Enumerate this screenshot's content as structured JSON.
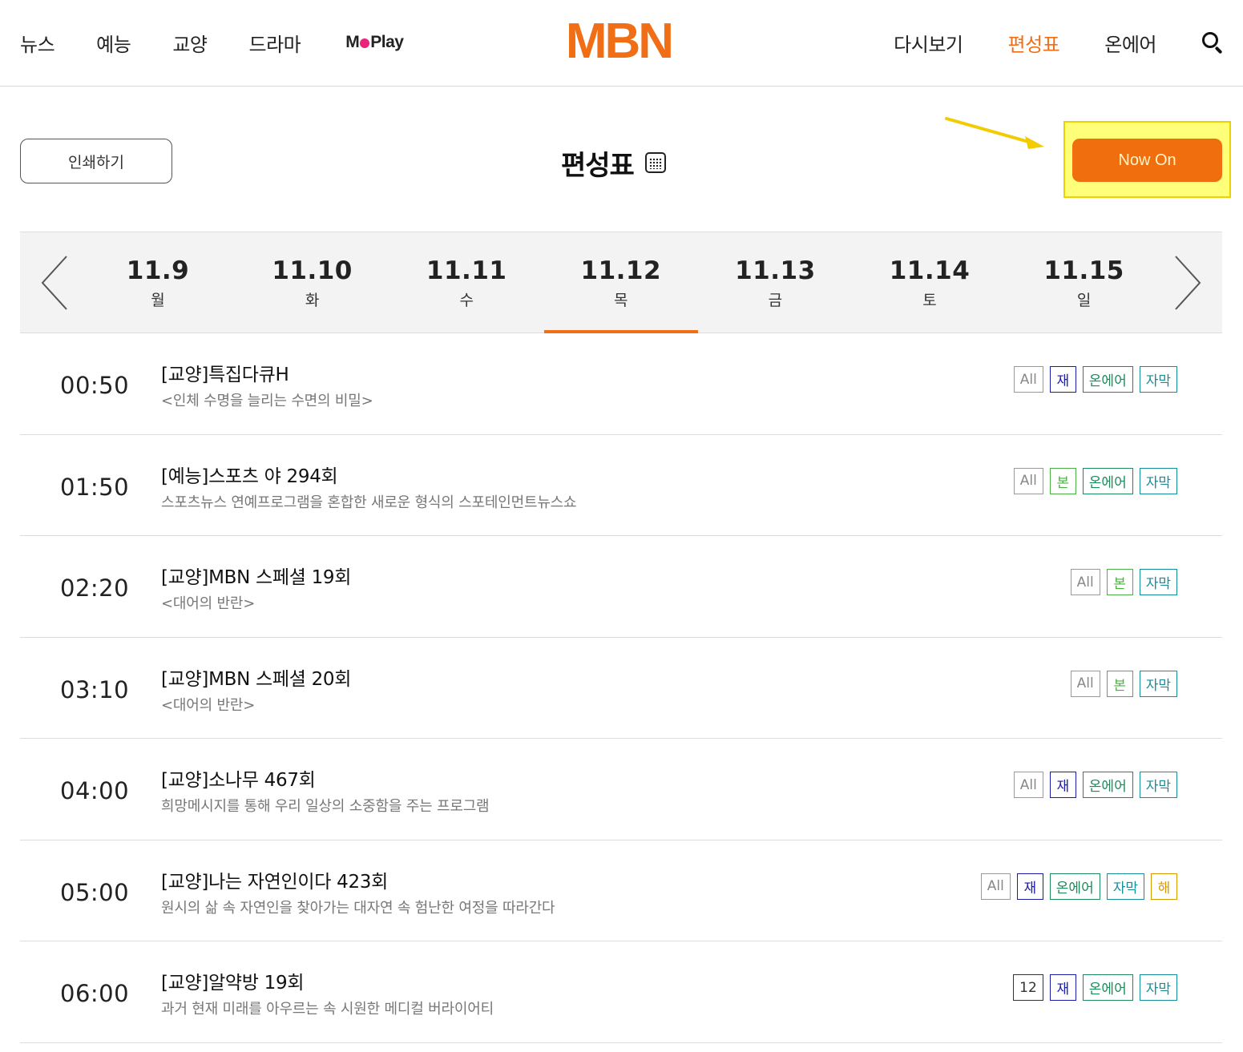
{
  "header": {
    "nav_left": [
      "뉴스",
      "예능",
      "교양",
      "드라마"
    ],
    "moplay": {
      "pre": "M",
      "post": "Play"
    },
    "logo": "MBN",
    "nav_right": [
      {
        "label": "다시보기",
        "active": false
      },
      {
        "label": "편성표",
        "active": true
      },
      {
        "label": "온에어",
        "active": false
      }
    ]
  },
  "print_label": "인쇄하기",
  "page_title": "편성표",
  "now_on_label": "Now On",
  "dates": [
    {
      "date": "11.9",
      "weekday": "월",
      "active": false
    },
    {
      "date": "11.10",
      "weekday": "화",
      "active": false
    },
    {
      "date": "11.11",
      "weekday": "수",
      "active": false
    },
    {
      "date": "11.12",
      "weekday": "목",
      "active": true
    },
    {
      "date": "11.13",
      "weekday": "금",
      "active": false
    },
    {
      "date": "11.14",
      "weekday": "토",
      "active": false
    },
    {
      "date": "11.15",
      "weekday": "일",
      "active": false
    }
  ],
  "schedule": [
    {
      "time": "00:50",
      "title": "[교양]특집다큐H",
      "desc": "<인체 수명을 늘리는 수면의 비밀>",
      "badges": [
        {
          "label": "All",
          "kind": "all"
        },
        {
          "label": "재",
          "kind": "re"
        },
        {
          "label": "온에어",
          "kind": "onair"
        },
        {
          "label": "자막",
          "kind": "sub"
        }
      ]
    },
    {
      "time": "01:50",
      "title": "[예능]스포츠 야 294회",
      "desc": "스포츠뉴스 연예프로그램을 혼합한 새로운 형식의 스포테인먼트뉴스쇼",
      "badges": [
        {
          "label": "All",
          "kind": "all"
        },
        {
          "label": "본",
          "kind": "orig"
        },
        {
          "label": "온에어",
          "kind": "onair"
        },
        {
          "label": "자막",
          "kind": "sub"
        }
      ]
    },
    {
      "time": "02:20",
      "title": "[교양]MBN 스페셜 19회",
      "desc": "<대어의 반란>",
      "badges": [
        {
          "label": "All",
          "kind": "all"
        },
        {
          "label": "본",
          "kind": "orig"
        },
        {
          "label": "자막",
          "kind": "sub"
        }
      ]
    },
    {
      "time": "03:10",
      "title": "[교양]MBN 스페셜 20회",
      "desc": "<대어의 반란>",
      "badges": [
        {
          "label": "All",
          "kind": "all"
        },
        {
          "label": "본",
          "kind": "orig"
        },
        {
          "label": "자막",
          "kind": "sub"
        }
      ]
    },
    {
      "time": "04:00",
      "title": "[교양]소나무 467회",
      "desc": "희망메시지를 통해 우리 일상의 소중함을 주는 프로그램",
      "badges": [
        {
          "label": "All",
          "kind": "all"
        },
        {
          "label": "재",
          "kind": "re"
        },
        {
          "label": "온에어",
          "kind": "onair"
        },
        {
          "label": "자막",
          "kind": "sub"
        }
      ]
    },
    {
      "time": "05:00",
      "title": "[교양]나는 자연인이다 423회",
      "desc": "원시의 삶 속 자연인을 찾아가는 대자연 속 험난한 여정을 따라간다",
      "badges": [
        {
          "label": "All",
          "kind": "all"
        },
        {
          "label": "재",
          "kind": "re"
        },
        {
          "label": "온에어",
          "kind": "onair"
        },
        {
          "label": "자막",
          "kind": "sub"
        },
        {
          "label": "해",
          "kind": "expl"
        }
      ]
    },
    {
      "time": "06:00",
      "title": "[교양]알약방 19회",
      "desc": "과거 현재 미래를 아우르는 속 시원한 메디컬 버라이어티",
      "badges": [
        {
          "label": "12",
          "kind": "rating"
        },
        {
          "label": "재",
          "kind": "re"
        },
        {
          "label": "온에어",
          "kind": "onair"
        },
        {
          "label": "자막",
          "kind": "sub"
        }
      ]
    }
  ]
}
